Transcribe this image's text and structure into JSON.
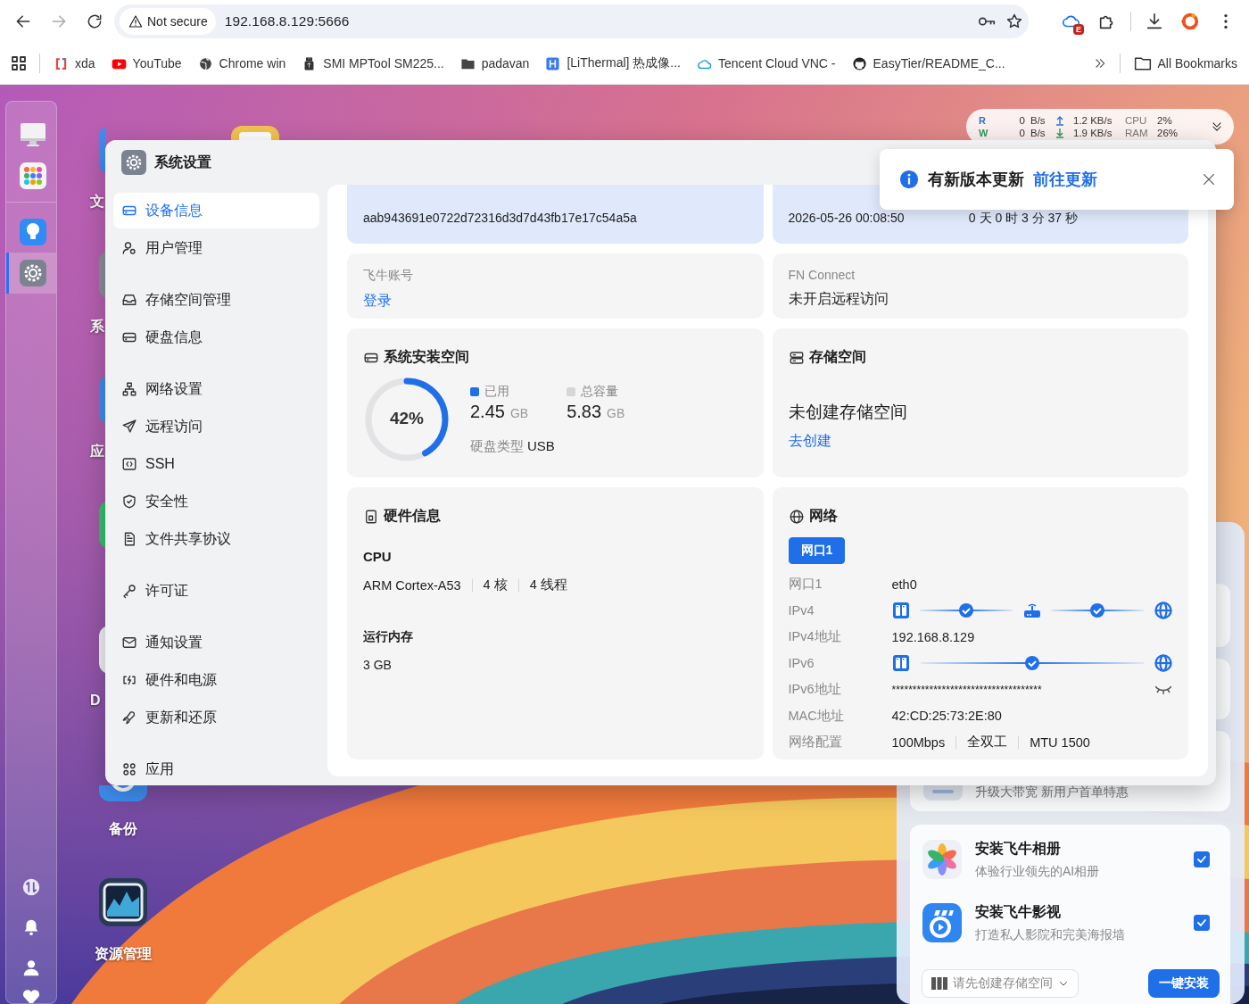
{
  "browser": {
    "security": "Not secure",
    "url": "192.168.8.129:5666",
    "extension_badge": "E",
    "bookmarks": [
      {
        "label": "xda"
      },
      {
        "label": "YouTube"
      },
      {
        "label": "Chrome win"
      },
      {
        "label": "SMI MPTool SM225..."
      },
      {
        "label": "padavan"
      },
      {
        "label": "[LiThermal] 热成像..."
      },
      {
        "label": "Tencent Cloud VNC -"
      },
      {
        "label": "EasyTier/README_C..."
      }
    ],
    "all_bookmarks": "All Bookmarks"
  },
  "dock": {
    "items": [
      {
        "selected": false
      },
      {
        "selected": false
      },
      {
        "selected": false
      },
      {
        "selected": true
      }
    ]
  },
  "desktop_icons": [
    {
      "label": "文"
    },
    {
      "label": "系"
    },
    {
      "label": "应"
    },
    {
      "label": "D"
    },
    {
      "label": "备份"
    },
    {
      "label": "资源管理"
    }
  ],
  "stats": {
    "rows": [
      {
        "io": "R",
        "color": "#2f6fdc",
        "disk": "0",
        "unit": "B/s",
        "net": "1.2 KB/s",
        "metric": "CPU",
        "value": "2%"
      },
      {
        "io": "W",
        "color": "#2e9a5a",
        "disk": "0",
        "unit": "B/s",
        "net": "1.9 KB/s",
        "metric": "RAM",
        "value": "26%"
      }
    ]
  },
  "toast": {
    "message": "有新版本更新",
    "link": "前往更新"
  },
  "window": {
    "title": "系统设置",
    "sidebar": [
      {
        "items": [
          {
            "label": "设备信息",
            "selected": true
          },
          {
            "label": "用户管理",
            "selected": false
          }
        ]
      },
      {
        "items": [
          {
            "label": "存储空间管理",
            "selected": false
          },
          {
            "label": "硬盘信息",
            "selected": false
          }
        ]
      },
      {
        "items": [
          {
            "label": "网络设置",
            "selected": false
          },
          {
            "label": "远程访问",
            "selected": false
          },
          {
            "label": "SSH",
            "selected": false
          },
          {
            "label": "安全性",
            "selected": false
          },
          {
            "label": "文件共享协议",
            "selected": false
          }
        ]
      },
      {
        "items": [
          {
            "label": "许可证",
            "selected": false
          }
        ]
      },
      {
        "items": [
          {
            "label": "通知设置",
            "selected": false
          },
          {
            "label": "硬件和电源",
            "selected": false
          },
          {
            "label": "更新和还原",
            "selected": false
          }
        ]
      },
      {
        "items": [
          {
            "label": "应用",
            "selected": false
          }
        ]
      }
    ],
    "device": {
      "id": "aab943691e0722d72316d3d7d43fb17e17c54a5a",
      "time": "2026-05-26 00:08:50",
      "uptime": "0 天 0 时 3 分 37 秒"
    },
    "account": {
      "label": "飞牛账号",
      "action": "登录"
    },
    "connect": {
      "label": "FN Connect",
      "value": "未开启远程访问"
    },
    "system_space": {
      "title": "系统安装空间",
      "level": 0.42,
      "percent": "42%",
      "used": {
        "label": "已用",
        "value": "2.45",
        "unit": "GB"
      },
      "total": {
        "label": "总容量",
        "value": "5.83",
        "unit": "GB"
      },
      "disk_type_label": "硬盘类型",
      "disk_type": "USB"
    },
    "storage": {
      "title": "存储空间",
      "status": "未创建存储空间",
      "action": "去创建"
    },
    "hardware": {
      "title": "硬件信息",
      "cpu_label": "CPU",
      "cpu": [
        "ARM Cortex-A53",
        "4 核",
        "4 线程"
      ],
      "memory_label": "运行内存",
      "memory": "3 GB"
    },
    "network": {
      "title": "网络",
      "tabs": [
        {
          "label": "网口1",
          "selected": true
        }
      ],
      "rows": [
        {
          "kind": "text",
          "label": "网口1",
          "values": [
            "eth0"
          ]
        },
        {
          "kind": "path",
          "label": "IPv4",
          "router": true
        },
        {
          "kind": "text",
          "label": "IPv4地址",
          "values": [
            "192.168.8.129"
          ]
        },
        {
          "kind": "path",
          "label": "IPv6",
          "router": false
        },
        {
          "kind": "secret",
          "label": "IPv6地址",
          "values": [
            "************************************"
          ]
        },
        {
          "kind": "text",
          "label": "MAC地址",
          "values": [
            "42:CD:25:73:2E:80"
          ]
        },
        {
          "kind": "text",
          "label": "网络配置",
          "values": [
            "100Mbps",
            "全双工",
            "MTU 1500"
          ]
        }
      ]
    }
  },
  "promo": {
    "note": "升级大带宽 新用户首单特惠",
    "apps": [
      {
        "title": "安装飞牛相册",
        "desc": "体验行业领先的AI相册",
        "checked": true
      },
      {
        "title": "安装飞牛影视",
        "desc": "打造私人影院和完美海报墙",
        "checked": true
      }
    ],
    "storage_select": "请先创建存储空间",
    "install": "一键安装"
  }
}
